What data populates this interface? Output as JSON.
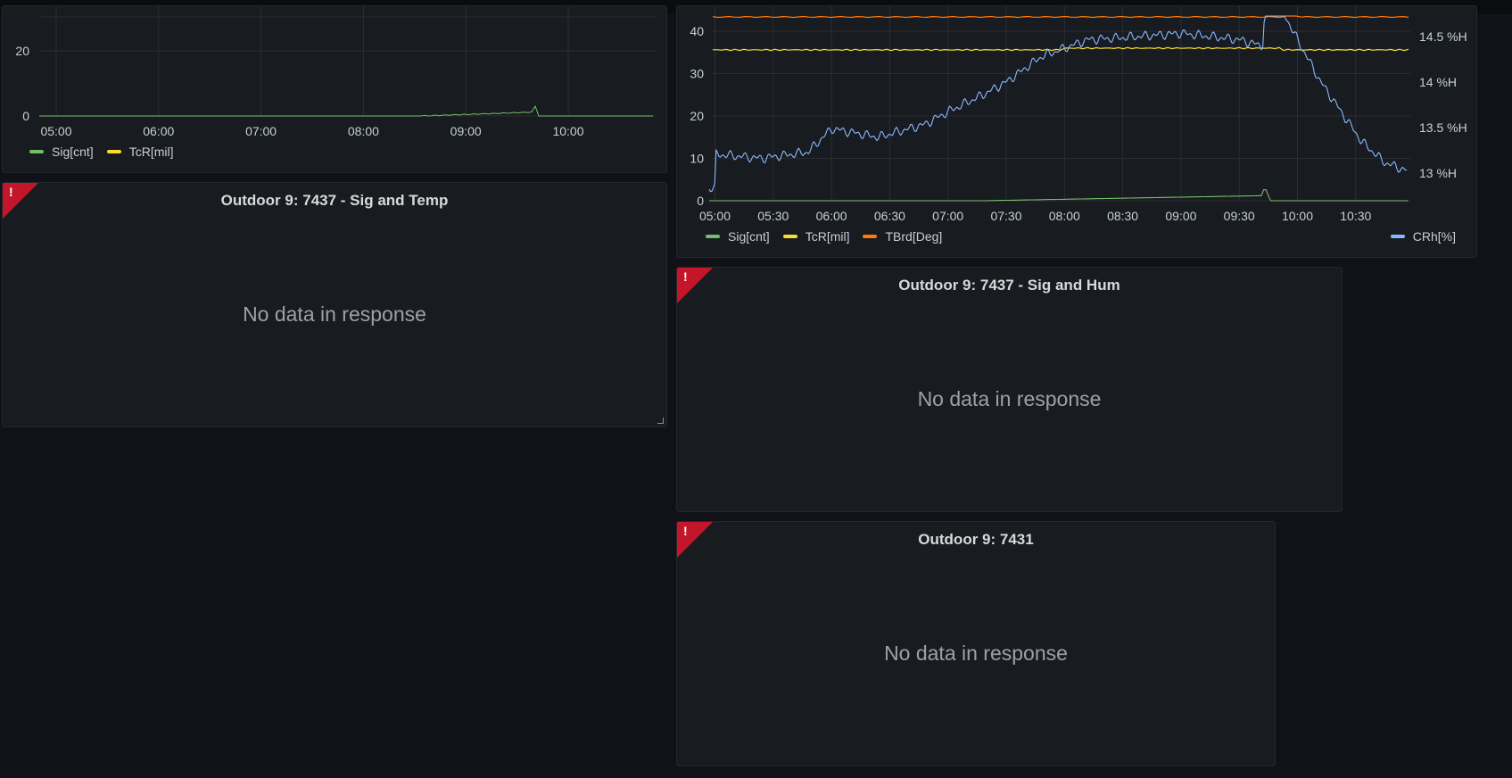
{
  "colors": {
    "background": "#111217",
    "panel": "#181b1f",
    "error": "#c4162a",
    "sig": "#73bf69",
    "tcr": "#fade2a",
    "tbrd": "#ff780a",
    "crh": "#8ab8ff"
  },
  "panels": {
    "top_left": {
      "y_ticks": [
        "20",
        "0"
      ],
      "x_ticks": [
        "05:00",
        "06:00",
        "07:00",
        "08:00",
        "09:00",
        "10:00"
      ],
      "legend": [
        {
          "label": "Sig[cnt]",
          "color": "#73bf69"
        },
        {
          "label": "TcR[mil]",
          "color": "#fade2a"
        }
      ]
    },
    "top_right": {
      "y_left_ticks": [
        "40",
        "30",
        "20",
        "10",
        "0"
      ],
      "y_right_ticks": [
        "14.5 %H",
        "14 %H",
        "13.5 %H",
        "13 %H"
      ],
      "x_ticks": [
        "05:00",
        "05:30",
        "06:00",
        "06:30",
        "07:00",
        "07:30",
        "08:00",
        "08:30",
        "09:00",
        "09:30",
        "10:00",
        "10:30"
      ],
      "legend_left": [
        {
          "label": "Sig[cnt]",
          "color": "#73bf69"
        },
        {
          "label": "TcR[mil]",
          "color": "#fade2a"
        },
        {
          "label": "TBrd[Deg]",
          "color": "#ff780a"
        }
      ],
      "legend_right": [
        {
          "label": "CRh[%]",
          "color": "#8ab8ff"
        }
      ]
    },
    "sig_temp": {
      "title": "Outdoor 9: 7437 - Sig and Temp",
      "message": "No data in response",
      "error_icon": "!"
    },
    "sig_hum": {
      "title": "Outdoor 9: 7437 - Sig and Hum",
      "message": "No data in response",
      "error_icon": "!"
    },
    "p7431": {
      "title": "Outdoor 9: 7431",
      "message": "No data in response",
      "error_icon": "!"
    }
  }
}
